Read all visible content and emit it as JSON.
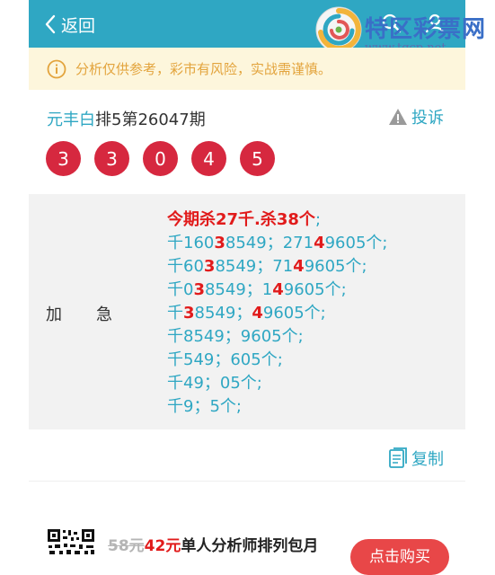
{
  "header": {
    "back_label": "返回",
    "logo_name": "特区彩票网",
    "logo_url": "www.tqcp.net",
    "background_color": "#2fa7c3"
  },
  "notice": {
    "text": "分析仅供参考，彩市有风险，实战需谨慎。",
    "icon": "info-icon",
    "color": "#e3a43d"
  },
  "issue": {
    "author": "元丰白",
    "game_and_number": "排5第26047期",
    "complain_label": "投诉",
    "balls": [
      "3",
      "3",
      "0",
      "4",
      "5"
    ],
    "ball_color": "#d6283f"
  },
  "prediction": {
    "label_1": "加",
    "label_2": "急",
    "head": "今期杀27千.杀38个",
    "head_sep": ";",
    "lines": [
      {
        "a": "千160",
        "b": "3",
        "c": "8549；271",
        "d": "4",
        "e": "9605个;"
      },
      {
        "a": "千60",
        "b": "3",
        "c": "8549；71",
        "d": "4",
        "e": "9605个;"
      },
      {
        "a": "千0",
        "b": "3",
        "c": "8549；1",
        "d": "4",
        "e": "9605个;"
      },
      {
        "a": "千",
        "b": "3",
        "c": "8549；",
        "d": "4",
        "e": "9605个;"
      },
      {
        "text": "千8549；9605个;"
      },
      {
        "text": "千549；605个;"
      },
      {
        "text": "千49；05个;"
      },
      {
        "text": "千9；5个;"
      }
    ]
  },
  "actions": {
    "copy_label": "复制"
  },
  "promo": {
    "old_price": "58元",
    "new_price": "42元",
    "title": "单人分析师排列包月",
    "buy_label": "点击购买"
  }
}
